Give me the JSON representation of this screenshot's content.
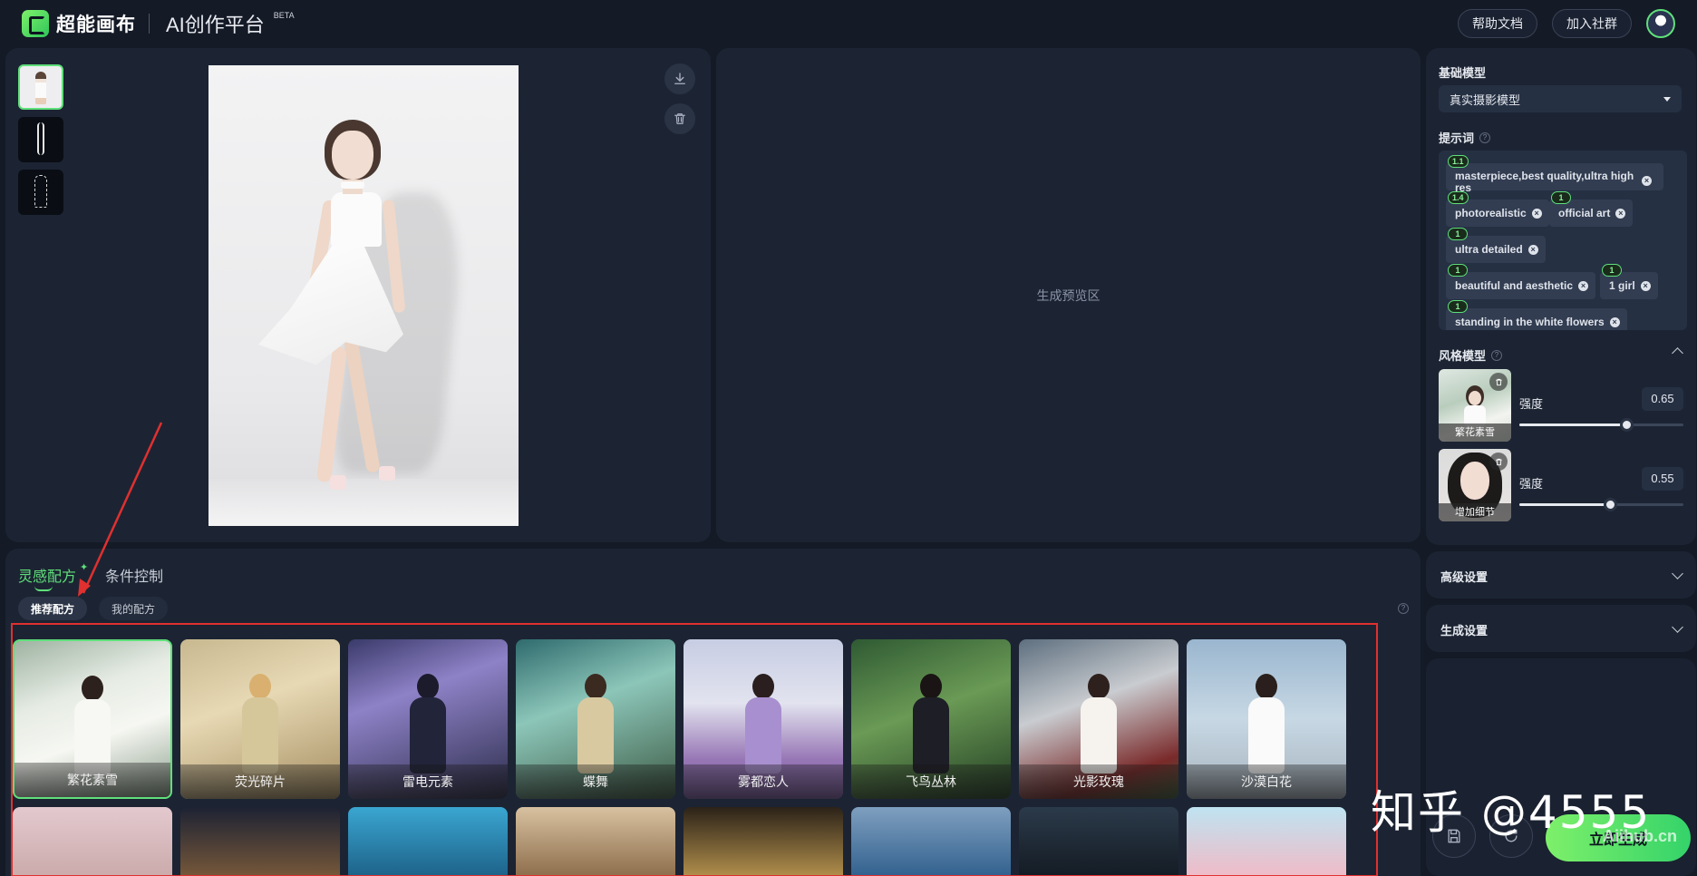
{
  "header": {
    "brand": "超能画布",
    "platform": "AI创作平台",
    "beta": "BETA",
    "help_label": "帮助文档",
    "community_label": "加入社群"
  },
  "source": {
    "download_icon": "download-icon",
    "delete_icon": "trash-icon"
  },
  "preview": {
    "placeholder": "生成预览区"
  },
  "right": {
    "base_model_label": "基础模型",
    "base_model_value": "真实摄影模型",
    "prompt_label": "提示词",
    "tags": [
      {
        "weight": "1.1",
        "text": "masterpiece,best quality,ultra high res"
      },
      {
        "weight": "1.4",
        "text": "photorealistic"
      },
      {
        "weight": "1",
        "text": "official art"
      },
      {
        "weight": "1",
        "text": "ultra detailed"
      },
      {
        "weight": "1",
        "text": "beautiful and aesthetic"
      },
      {
        "weight": "1",
        "text": "1 girl"
      },
      {
        "weight": "1",
        "text": "standing in the white flowers"
      }
    ],
    "style_label": "风格模型",
    "styles": [
      {
        "name": "繁花素雪",
        "strength_label": "强度",
        "strength": "0.65",
        "level": 0.65
      },
      {
        "name": "增加细节",
        "strength_label": "强度",
        "strength": "0.55",
        "level": 0.55
      }
    ],
    "advanced_label": "高级设置",
    "generate_settings_label": "生成设置"
  },
  "bottom": {
    "tab_inspiration": "灵感配方",
    "tab_control": "条件控制",
    "pill_recommended": "推荐配方",
    "pill_mine": "我的配方",
    "cards": [
      "繁花素雪",
      "荧光碎片",
      "雷电元素",
      "蝶舞",
      "雾都恋人",
      "飞鸟丛林",
      "光影玫瑰",
      "沙漠白花"
    ]
  },
  "actions": {
    "generate_label": "立即生成",
    "watermark": "知乎 @4555",
    "watermark_small": "Aiihub.cn"
  },
  "colors": {
    "accent": "#5fe07a",
    "highlight": "#e0302f",
    "panel": "#1c2433"
  }
}
